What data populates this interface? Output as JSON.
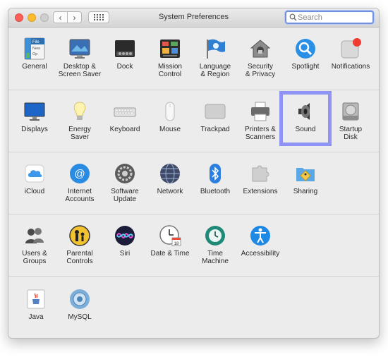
{
  "window": {
    "title": "System Preferences"
  },
  "toolbar": {
    "back_glyph": "‹",
    "forward_glyph": "›"
  },
  "search": {
    "placeholder": "Search",
    "value": ""
  },
  "sections": [
    {
      "items": [
        {
          "id": "general",
          "label": "General",
          "icon": "general-icon"
        },
        {
          "id": "desktop",
          "label": "Desktop &\nScreen Saver",
          "icon": "desktop-icon"
        },
        {
          "id": "dock",
          "label": "Dock",
          "icon": "dock-icon"
        },
        {
          "id": "mission",
          "label": "Mission\nControl",
          "icon": "mission-control-icon"
        },
        {
          "id": "language",
          "label": "Language\n& Region",
          "icon": "flag-icon"
        },
        {
          "id": "security",
          "label": "Security\n& Privacy",
          "icon": "house-lock-icon"
        },
        {
          "id": "spotlight",
          "label": "Spotlight",
          "icon": "magnifier-icon"
        },
        {
          "id": "notifications",
          "label": "Notifications",
          "icon": "notifications-icon"
        }
      ]
    },
    {
      "items": [
        {
          "id": "displays",
          "label": "Displays",
          "icon": "monitor-icon"
        },
        {
          "id": "energy",
          "label": "Energy\nSaver",
          "icon": "lightbulb-icon"
        },
        {
          "id": "keyboard",
          "label": "Keyboard",
          "icon": "keyboard-icon"
        },
        {
          "id": "mouse",
          "label": "Mouse",
          "icon": "mouse-icon"
        },
        {
          "id": "trackpad",
          "label": "Trackpad",
          "icon": "trackpad-icon"
        },
        {
          "id": "printers",
          "label": "Printers &\nScanners",
          "icon": "printer-icon"
        },
        {
          "id": "sound",
          "label": "Sound",
          "icon": "speaker-icon"
        },
        {
          "id": "startup",
          "label": "Startup\nDisk",
          "icon": "hard-disk-icon"
        }
      ]
    },
    {
      "items": [
        {
          "id": "icloud",
          "label": "iCloud",
          "icon": "cloud-icon"
        },
        {
          "id": "internet",
          "label": "Internet\nAccounts",
          "icon": "at-sign-icon"
        },
        {
          "id": "software",
          "label": "Software\nUpdate",
          "icon": "gear-icon"
        },
        {
          "id": "network",
          "label": "Network",
          "icon": "globe-icon"
        },
        {
          "id": "bluetooth",
          "label": "Bluetooth",
          "icon": "bluetooth-icon"
        },
        {
          "id": "extensions",
          "label": "Extensions",
          "icon": "puzzle-icon"
        },
        {
          "id": "sharing",
          "label": "Sharing",
          "icon": "folder-sign-icon"
        }
      ]
    },
    {
      "items": [
        {
          "id": "users",
          "label": "Users &\nGroups",
          "icon": "users-icon"
        },
        {
          "id": "parental",
          "label": "Parental\nControls",
          "icon": "parental-icon"
        },
        {
          "id": "siri",
          "label": "Siri",
          "icon": "siri-icon"
        },
        {
          "id": "datetime",
          "label": "Date & Time",
          "icon": "clock-icon",
          "calendar_day": "18"
        },
        {
          "id": "timemachine",
          "label": "Time\nMachine",
          "icon": "time-machine-icon"
        },
        {
          "id": "accessibility",
          "label": "Accessibility",
          "icon": "accessibility-icon"
        }
      ]
    },
    {
      "items": [
        {
          "id": "java",
          "label": "Java",
          "icon": "java-icon"
        },
        {
          "id": "mysql",
          "label": "MySQL",
          "icon": "mysql-icon"
        }
      ]
    }
  ],
  "general_icon_text": [
    "File",
    "New",
    "Op"
  ],
  "highlight": {
    "item": "sound",
    "color": "#8f93f5"
  }
}
